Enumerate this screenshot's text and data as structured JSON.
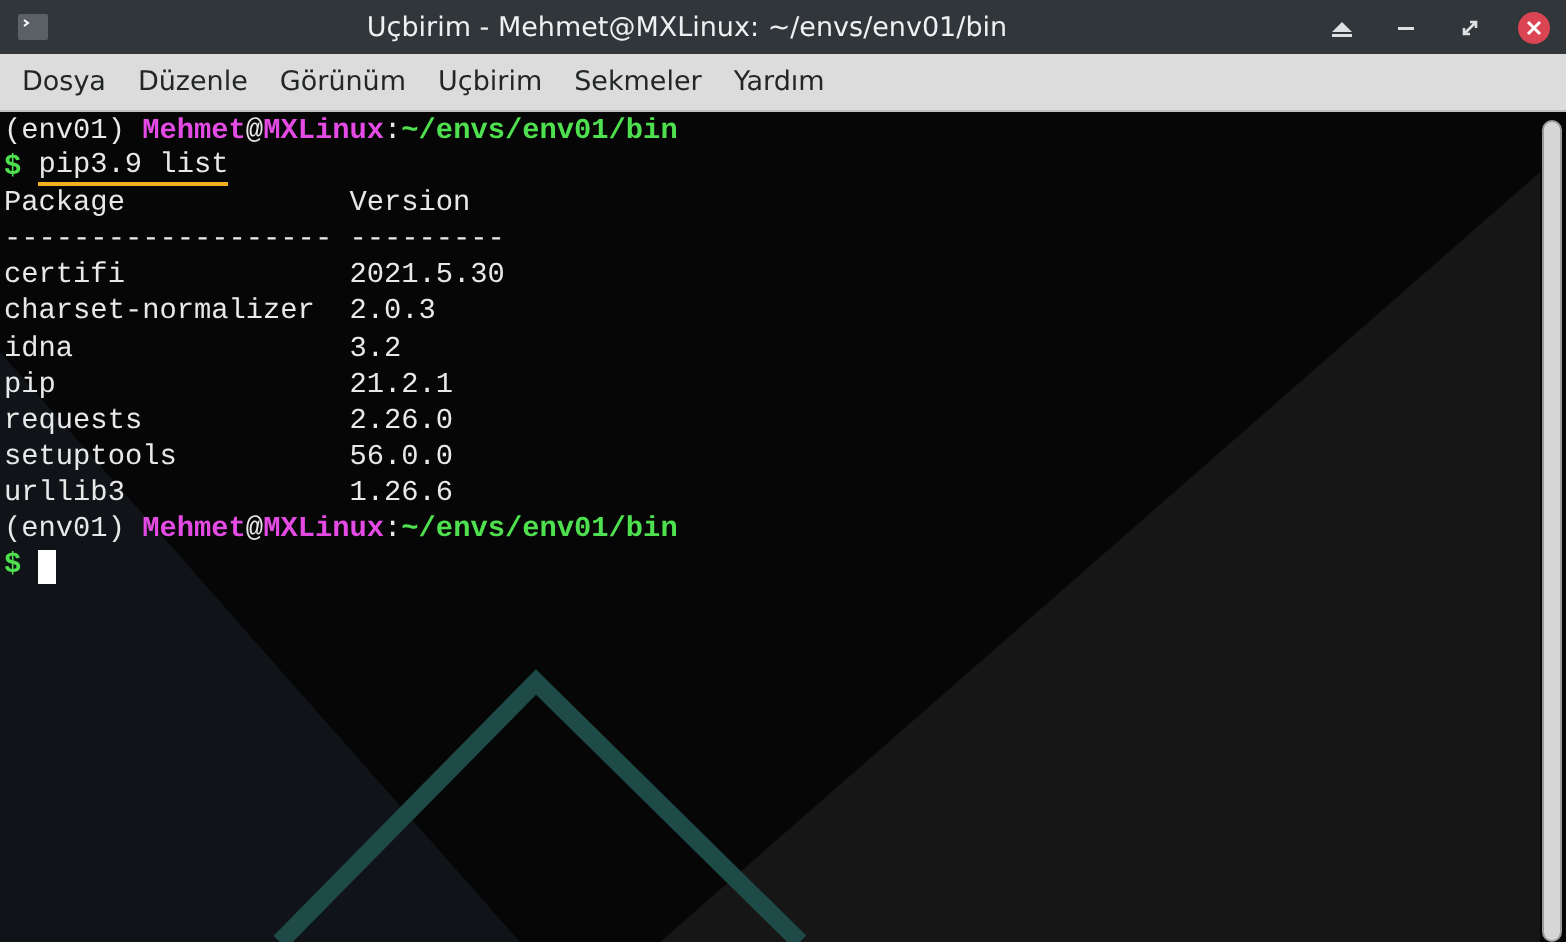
{
  "window": {
    "title": "Uçbirim - Mehmet@MXLinux: ~/envs/env01/bin"
  },
  "menu": [
    "Dosya",
    "Düzenle",
    "Görünüm",
    "Uçbirim",
    "Sekmeler",
    "Yardım"
  ],
  "terminal": {
    "lines": [
      {
        "kind": "prompt",
        "env": "(env01)",
        "user": "Mehmet",
        "at": "@",
        "host": "MXLinux",
        "sep": ":",
        "path": "~/envs/env01/bin"
      },
      {
        "kind": "command",
        "symbol": "$",
        "text": "pip3.9 list",
        "highlighted": true
      },
      {
        "kind": "output",
        "text": "Package             Version"
      },
      {
        "kind": "output",
        "text": "------------------- ---------"
      },
      {
        "kind": "output",
        "text": "certifi             2021.5.30"
      },
      {
        "kind": "output",
        "text": "charset-normalizer  2.0.3"
      },
      {
        "kind": "output",
        "text": "idna                3.2"
      },
      {
        "kind": "output",
        "text": "pip                 21.2.1"
      },
      {
        "kind": "output",
        "text": "requests            2.26.0"
      },
      {
        "kind": "output",
        "text": "setuptools          56.0.0"
      },
      {
        "kind": "output",
        "text": "urllib3             1.26.6"
      },
      {
        "kind": "prompt",
        "env": "(env01)",
        "user": "Mehmet",
        "at": "@",
        "host": "MXLinux",
        "sep": ":",
        "path": "~/envs/env01/bin"
      },
      {
        "kind": "cursor",
        "symbol": "$"
      }
    ]
  }
}
